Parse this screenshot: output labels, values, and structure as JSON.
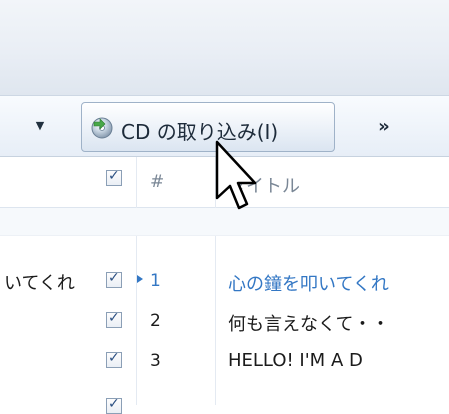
{
  "toolbar": {
    "dropdown_glyph": "▼",
    "rip_button_label": "CD の取り込み(I)",
    "rip_icon": "cd-rip-icon",
    "more_label": "»"
  },
  "columns": {
    "number_header": "#",
    "title_header": "タイトル"
  },
  "rows": [
    {
      "left_text": "いてくれ",
      "number": "1",
      "title": "心の鐘を叩いてくれ",
      "checked": true,
      "playing": true
    },
    {
      "left_text": "",
      "number": "2",
      "title": "何も言えなくて・・",
      "checked": true,
      "playing": false
    },
    {
      "left_text": "",
      "number": "3",
      "title": "HELLO!  I'M  A  D",
      "checked": true,
      "playing": false
    }
  ],
  "colors": {
    "accent_playing": "#3377c4",
    "toolbar_border": "#9fb2c8"
  },
  "cursor": "arrow-pointer-icon"
}
